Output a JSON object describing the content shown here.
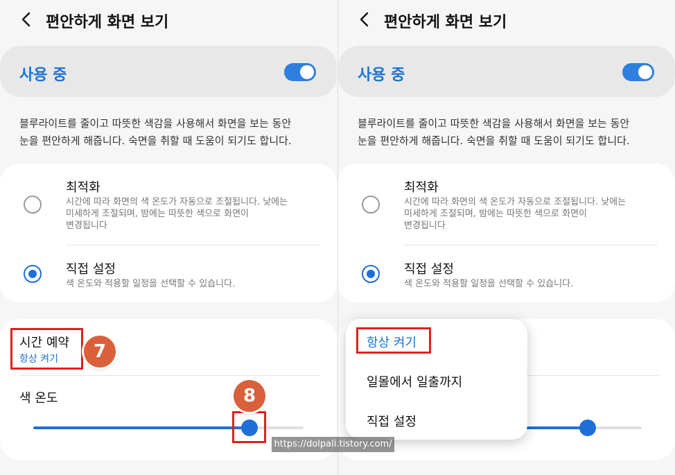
{
  "header": {
    "title": "편안하게 화면 보기"
  },
  "master": {
    "label": "사용 중",
    "enabled": true
  },
  "description": {
    "line1": "블루라이트를 줄이고 따뜻한 색감을 사용해서 화면을 보는 동안",
    "line2": "눈을 편안하게 해줍니다. 숙면을 취할 때 도움이 되기도 합니다."
  },
  "options": [
    {
      "title": "최적화",
      "sub1": "시간에 따라 화면의 색 온도가 자동으로 조절됩니다. 낮에는",
      "sub2": "미세하게 조절되며, 밤에는 따뜻한 색으로 화면이",
      "sub3": "변경됩니다",
      "selected": false
    },
    {
      "title": "직접 설정",
      "sub1": "색 온도와 적용할 일정을 선택할 수 있습니다.",
      "selected": true
    }
  ],
  "schedule": {
    "title": "시간 예약",
    "value": "항상 켜기"
  },
  "color_temp": {
    "title": "색 온도",
    "level_percent": 80
  },
  "annotations": {
    "step7": "7",
    "step8": "8"
  },
  "dropdown": {
    "items": [
      "항상 켜기",
      "일몰에서 일출까지",
      "직접 설정"
    ],
    "selected_index": 0
  },
  "watermark": "https://dolpali.tistory.com/",
  "colors": {
    "accent": "#1f6fd8",
    "highlight_box": "#e02020",
    "badge": "#d9603b"
  }
}
